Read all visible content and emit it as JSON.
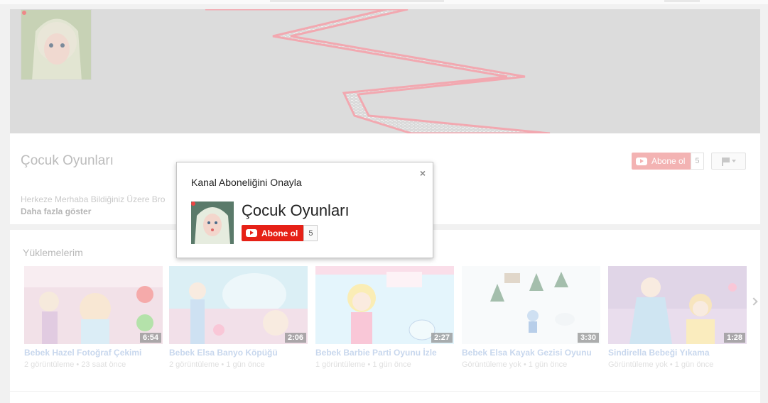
{
  "channel": {
    "name": "Çocuk Oyunları",
    "description": "Herkeze Merhaba Bildiğiniz Üzere Bro",
    "show_more": "Daha fazla göster",
    "subscribe_label": "Abone ol",
    "subscriber_count": "5"
  },
  "uploads": {
    "title": "Yüklemelerim",
    "videos": [
      {
        "title": "Bebek Hazel Fotoğraf Çekimi",
        "views": "2 görüntüleme",
        "age": "23 saat önce",
        "duration": "6:54"
      },
      {
        "title": "Bebek Elsa Banyo Köpüğü",
        "views": "2 görüntüleme",
        "age": "1 gün önce",
        "duration": "2:06"
      },
      {
        "title": "Bebek Barbie Parti Oyunu İzle",
        "views": "1 görüntüleme",
        "age": "1 gün önce",
        "duration": "2:27"
      },
      {
        "title": "Bebek Elsa Kayak Gezisi Oyunu",
        "views": "Görüntüleme yok",
        "age": "1 gün önce",
        "duration": "3:30"
      },
      {
        "title": "Sindirella Bebeği Yıkama",
        "views": "Görüntüleme yok",
        "age": "1 gün önce",
        "duration": "1:28"
      }
    ],
    "meta_separator": "•"
  },
  "modal": {
    "title": "Kanal Aboneliğini Onayla",
    "close": "×",
    "channel_name": "Çocuk Oyunları",
    "subscribe_label": "Abone ol",
    "subscriber_count": "5"
  },
  "colors": {
    "subscribe_red": "#e62117",
    "link_blue": "#167ac6"
  }
}
